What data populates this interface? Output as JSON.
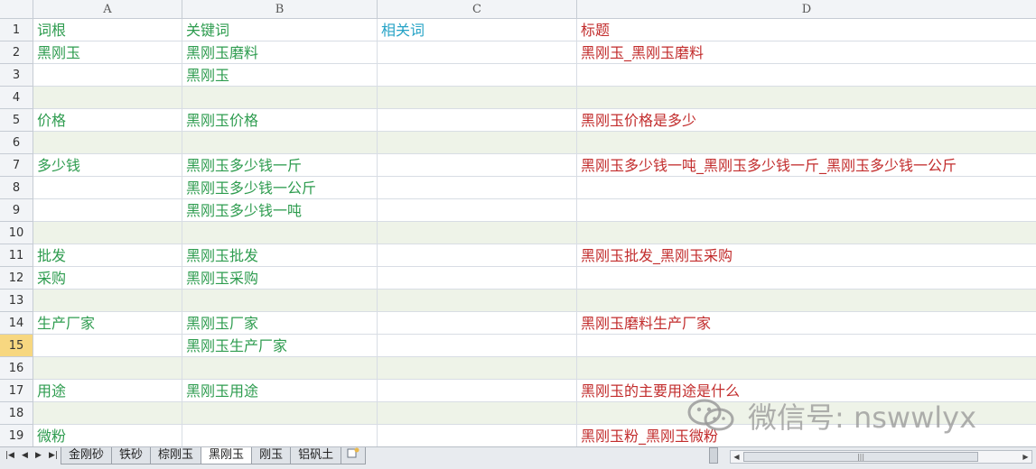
{
  "columns": [
    "A",
    "B",
    "C",
    "D"
  ],
  "rows": [
    {
      "num": "1",
      "a": "词根",
      "b": "关键词",
      "c": "相关词",
      "d": "标题",
      "band": false
    },
    {
      "num": "2",
      "a": "黑刚玉",
      "b": "黑刚玉磨料",
      "c": "",
      "d": "黑刚玉_黑刚玉磨料",
      "band": false
    },
    {
      "num": "3",
      "a": "",
      "b": "黑刚玉",
      "c": "",
      "d": "",
      "band": false
    },
    {
      "num": "4",
      "a": "",
      "b": "",
      "c": "",
      "d": "",
      "band": true
    },
    {
      "num": "5",
      "a": "价格",
      "b": "黑刚玉价格",
      "c": "",
      "d": "黑刚玉价格是多少",
      "band": false
    },
    {
      "num": "6",
      "a": "",
      "b": "",
      "c": "",
      "d": "",
      "band": true
    },
    {
      "num": "7",
      "a": "多少钱",
      "b": "黑刚玉多少钱一斤",
      "c": "",
      "d": "黑刚玉多少钱一吨_黑刚玉多少钱一斤_黑刚玉多少钱一公斤",
      "band": false
    },
    {
      "num": "8",
      "a": "",
      "b": "黑刚玉多少钱一公斤",
      "c": "",
      "d": "",
      "band": false
    },
    {
      "num": "9",
      "a": "",
      "b": "黑刚玉多少钱一吨",
      "c": "",
      "d": "",
      "band": false
    },
    {
      "num": "10",
      "a": "",
      "b": "",
      "c": "",
      "d": "",
      "band": true
    },
    {
      "num": "11",
      "a": "批发",
      "b": "黑刚玉批发",
      "c": "",
      "d": "黑刚玉批发_黑刚玉采购",
      "band": false
    },
    {
      "num": "12",
      "a": "采购",
      "b": "黑刚玉采购",
      "c": "",
      "d": "",
      "band": false
    },
    {
      "num": "13",
      "a": "",
      "b": "",
      "c": "",
      "d": "",
      "band": true
    },
    {
      "num": "14",
      "a": "生产厂家",
      "b": "黑刚玉厂家",
      "c": "",
      "d": "黑刚玉磨料生产厂家",
      "band": false
    },
    {
      "num": "15",
      "a": "",
      "b": "黑刚玉生产厂家",
      "c": "",
      "d": "",
      "band": false,
      "selected": true
    },
    {
      "num": "16",
      "a": "",
      "b": "",
      "c": "",
      "d": "",
      "band": true
    },
    {
      "num": "17",
      "a": "用途",
      "b": "黑刚玉用途",
      "c": "",
      "d": "黑刚玉的主要用途是什么",
      "band": false
    },
    {
      "num": "18",
      "a": "",
      "b": "",
      "c": "",
      "d": "",
      "band": true
    },
    {
      "num": "19",
      "a": "微粉",
      "b": "",
      "c": "",
      "d": "黑刚玉粉_黑刚玉微粉",
      "band": false
    }
  ],
  "sheet_tabs": [
    "金刚砂",
    "铁砂",
    "棕刚玉",
    "黑刚玉",
    "刚玉",
    "铝矾土"
  ],
  "active_tab": "黑刚玉",
  "watermark": "微信号: nswwlyx",
  "colors": {
    "root": "#2e9c4f",
    "keyword": "#2e9c4f",
    "related": "#26a3c6",
    "title": "#c22c2c",
    "band": "#eef3e8"
  }
}
